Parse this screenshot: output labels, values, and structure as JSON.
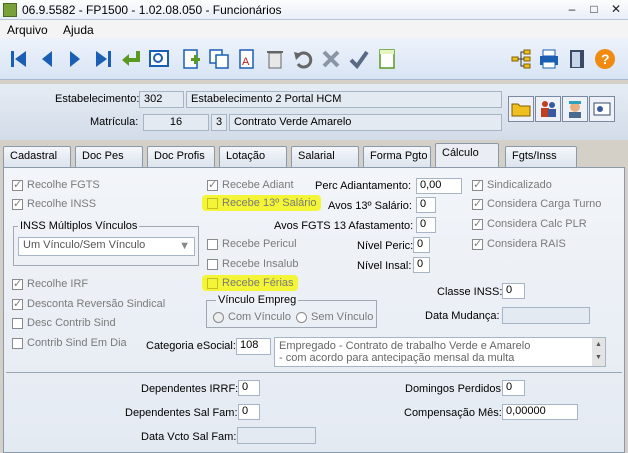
{
  "window": {
    "title": "06.9.5582 - FP1500 - 1.02.08.050 - Funcionários",
    "controls": {
      "min": "–",
      "max": "□",
      "close": "✕"
    }
  },
  "menu": [
    "Arquivo",
    "Ajuda"
  ],
  "toolbar": {
    "first": "first-icon",
    "prev": "prev-icon",
    "next": "next-icon",
    "last": "last-icon",
    "confirm": "return-icon",
    "search": "search-icon",
    "new": "new-doc-icon",
    "copy": "copy-icon",
    "edit": "edit-icon",
    "delete": "trash-icon",
    "undo": "undo-icon",
    "cancel": "cancel-icon",
    "save": "check-icon",
    "notes": "note-icon",
    "tree": "tree-icon",
    "print": "print-icon",
    "exit": "exit-icon",
    "help": "?"
  },
  "header": {
    "estabelecimento_label": "Estabelecimento:",
    "estabelecimento_code": "302",
    "estabelecimento_name": "Estabelecimento 2 Portal HCM",
    "matricula_label": "Matrícula:",
    "matricula_value": "16",
    "contrato_code": "3",
    "contrato_name": "Contrato Verde Amarelo"
  },
  "tabs": [
    "Cadastral",
    "Doc Pes",
    "Doc Profis",
    "Lotação",
    "Salarial",
    "Forma Pgto",
    "Cálculo",
    "Fgts/Inss"
  ],
  "calc": {
    "recolhe_fgts": "Recolhe FGTS",
    "recolhe_inss": "Recolhe INSS",
    "inss_multiplos": "INSS Múltiplos Vínculos",
    "inss_multiplos_value": "Um Vínculo/Sem Vínculo",
    "recolhe_irf": "Recolhe IRF",
    "desconta_reversao": "Desconta Reversão Sindical",
    "desc_contrib_sind": "Desc Contrib Sind",
    "contrib_sind_em_dia": "Contrib Sind Em Dia",
    "recebe_adiant": "Recebe Adiant",
    "recebe_13": "Recebe 13º Salário",
    "recebe_pericul": "Recebe Pericul",
    "recebe_insalub": "Recebe Insalub",
    "recebe_ferias": "Recebe Férias",
    "vinculo_empreg": "Vínculo Empreg",
    "com_vinculo": "Com Vínculo",
    "sem_vinculo": "Sem Vínculo",
    "perc_adiant_label": "Perc Adiantamento:",
    "perc_adiant_value": "0,00",
    "avos13_label": "Avos 13º Salário:",
    "avos13_value": "0",
    "avosfgts_label": "Avos FGTS 13 Afastamento:",
    "avosfgts_value": "0",
    "nivel_peric_label": "Nível Peric:",
    "nivel_peric_value": "0",
    "nivel_insal_label": "Nível Insal:",
    "nivel_insal_value": "0",
    "sindicalizado": "Sindicalizado",
    "considera_carga": "Considera Carga Turno",
    "considera_calc": "Considera Calc PLR",
    "considera_rais": "Considera RAIS",
    "classe_inss_label": "Classe INSS:",
    "classe_inss_value": "0",
    "data_mudanca_label": "Data Mudança:",
    "data_mudanca_value": "",
    "categoria_label": "Categoria eSocial:",
    "categoria_code": "108",
    "categoria_desc_1": "Empregado - Contrato de trabalho Verde e Amarelo",
    "categoria_desc_2": "- com acordo para antecipação mensal da multa",
    "dep_irrf_label": "Dependentes IRRF:",
    "dep_irrf_value": "0",
    "dep_salfam_label": "Dependentes Sal Fam:",
    "dep_salfam_value": "0",
    "data_vcto_label": "Data Vcto Sal Fam:",
    "data_vcto_value": "",
    "domingos_label": "Domingos Perdidos:",
    "domingos_value": "0",
    "compensacao_label": "Compensação Mês:",
    "compensacao_value": "0,00000"
  },
  "colors": {
    "highlight": "#f3f536",
    "accent": "#1a5fb4"
  }
}
